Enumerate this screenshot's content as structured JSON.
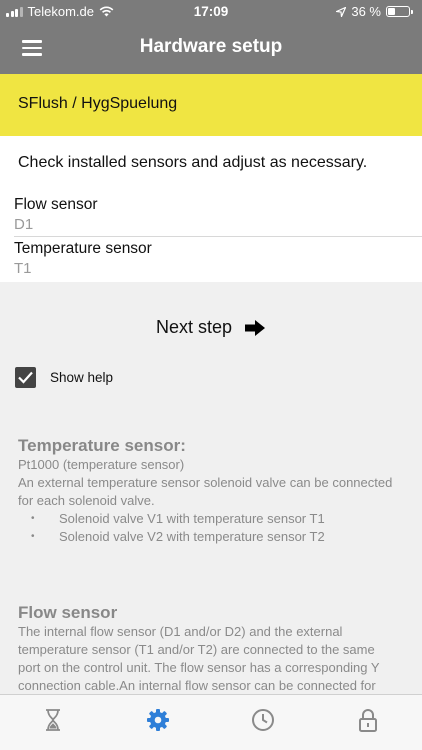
{
  "status_bar": {
    "carrier": "Telekom.de",
    "time": "17:09",
    "battery_percent": "36 %",
    "battery_level": 0.36
  },
  "nav": {
    "title": "Hardware setup",
    "menu_icon": "hamburger-menu-icon"
  },
  "section": {
    "title": "SFlush / HygSpuelung"
  },
  "content": {
    "intro": "Check installed sensors and adjust as necessary.",
    "sensors": [
      {
        "label": "Flow sensor",
        "value": "D1"
      },
      {
        "label": "Temperature sensor",
        "value": "T1"
      }
    ]
  },
  "actions": {
    "next_step": "Next step",
    "show_help": "Show help",
    "show_help_checked": true
  },
  "help": {
    "temperature": {
      "heading": "Temperature sensor:",
      "subtitle": "Pt1000 (temperature sensor)",
      "text": "An external temperature sensor solenoid valve can be connected for each solenoid valve.",
      "items": [
        "Solenoid valve V1 with temperature sensor T1",
        "Solenoid valve V2 with temperature sensor T2"
      ]
    },
    "flow": {
      "heading": "Flow sensor",
      "text": "The internal flow sensor (D1 and/or D2) and the external temperature sensor (T1 and/or T2) are connected to the same port on the control unit. The flow sensor has a corresponding Y connection cable.An internal flow sensor can be connected for"
    }
  },
  "tabbar": {
    "tabs": [
      "hourglass-icon",
      "gear-icon",
      "clock-icon",
      "lock-icon"
    ],
    "active": "gear-icon"
  },
  "colors": {
    "header_bg": "#7b7b7b",
    "section_bg": "#f0e542",
    "accent": "#2f7fd8",
    "tab_icon": "#8a8a8a"
  }
}
